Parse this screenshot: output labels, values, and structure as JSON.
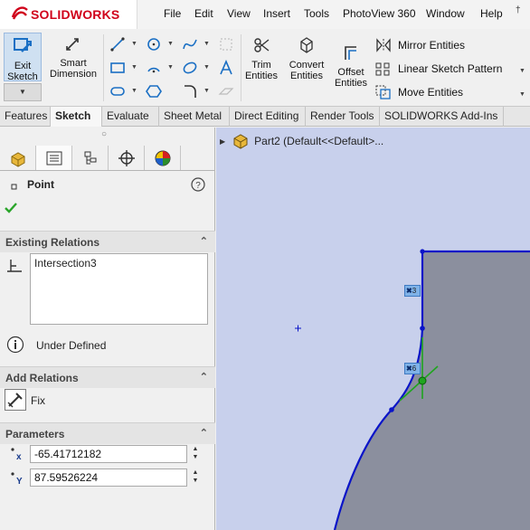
{
  "app": {
    "logo_text": "SOLIDWORKS"
  },
  "menu": [
    "File",
    "Edit",
    "View",
    "Insert",
    "Tools",
    "PhotoView 360",
    "Window",
    "Help"
  ],
  "ribbon": {
    "exit_sketch": [
      "Exit",
      "Sketch"
    ],
    "smart_dimension": [
      "Smart",
      "Dimension"
    ],
    "trim_entities": [
      "Trim",
      "Entities"
    ],
    "convert_entities": [
      "Convert",
      "Entities"
    ],
    "offset_entities": [
      "Offset",
      "Entities"
    ],
    "mirror_entities": "Mirror Entities",
    "linear_sketch_pattern": "Linear Sketch Pattern",
    "move_entities": "Move Entities"
  },
  "tabs": [
    {
      "label": "Features",
      "active": false
    },
    {
      "label": "Sketch",
      "active": true
    },
    {
      "label": "Evaluate",
      "active": false
    },
    {
      "label": "Sheet Metal",
      "active": false
    },
    {
      "label": "Direct Editing",
      "active": false
    },
    {
      "label": "Render Tools",
      "active": false
    },
    {
      "label": "SOLIDWORKS Add-Ins",
      "active": false
    }
  ],
  "property_manager": {
    "title": "Point",
    "existing_relations": {
      "header": "Existing Relations",
      "items": [
        "Intersection3"
      ],
      "status": "Under Defined"
    },
    "add_relations": {
      "header": "Add Relations",
      "fix_label": "Fix"
    },
    "parameters": {
      "header": "Parameters",
      "x_value": "-65.41712182",
      "y_value": "87.59526224"
    }
  },
  "feature_tree": {
    "root_label": "Part2  (Default<<Default>..."
  },
  "sketch_tags": [
    "3",
    "6"
  ],
  "colors": {
    "accent_red": "#d0021b",
    "sketch_blue": "#0a14c8",
    "canvas_bg": "#c8d0ec",
    "solid_gray": "#8b8f9e",
    "relation_green": "#1fa51f"
  }
}
